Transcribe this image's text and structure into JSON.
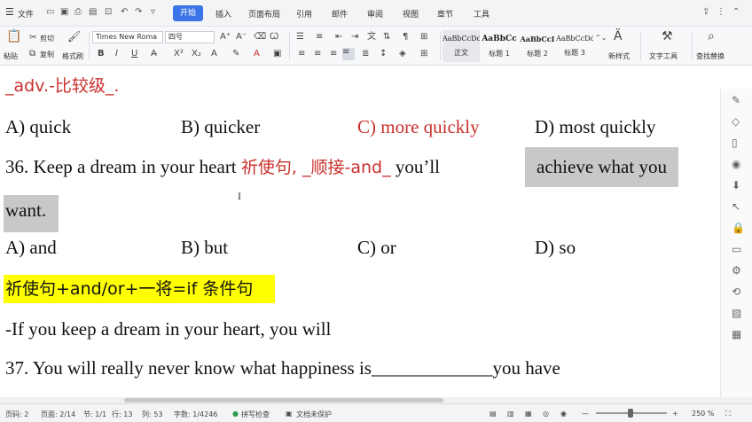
{
  "menubar": {
    "menu_icon": "☰",
    "file": "文件",
    "tabs": [
      "开始",
      "插入",
      "页面布局",
      "引用",
      "邮件",
      "审阅",
      "视图",
      "章节",
      "工具"
    ]
  },
  "ribbon": {
    "paste": "粘贴",
    "cut": "剪切",
    "copy": "复制",
    "format_painter": "格式刷",
    "font_name": "Times New Roma",
    "font_size": "四号",
    "styles": [
      {
        "sample": "AaBbCcDd",
        "name": "正文"
      },
      {
        "sample": "AaBbCc",
        "name": "标题 1"
      },
      {
        "sample": "AaBbCcI",
        "name": "标题 2"
      },
      {
        "sample": "AaBbCcDd",
        "name": "标题 3"
      }
    ],
    "new_style": "新样式",
    "text_tools": "文字工具",
    "find_replace": "查找替换"
  },
  "document": {
    "line1": "_adv.-比较级_.",
    "q35_options": [
      "A) quick",
      "B) quicker",
      "C) more quickly",
      "D) most quickly"
    ],
    "q36_prefix": "36. Keep a dream in your heart ",
    "q36_hint": "祈使句, _顺接-and_",
    "q36_middle": " you’ll ",
    "q36_highlight1": "achieve what you",
    "q36_highlight2": "want.",
    "q36_options": [
      "A) and",
      "B) but",
      "C) or",
      "D) so"
    ],
    "rule": "祈使句+and/or+一将=if 条件句",
    "example": "-If you keep a dream in your heart, you will",
    "q37": "37.  You  will  really  never  know  what  happiness  is_____________you  have"
  },
  "statusbar": {
    "page": "页码: 2",
    "pages": "页面: 2/14",
    "section": "节: 1/1",
    "row": "行: 13",
    "col": "列: 53",
    "words": "字数: 1/4246",
    "spell": "拼写检查",
    "protect": "文档未保护",
    "zoom": "250 %"
  },
  "colors": {
    "accent": "#3b74e6",
    "hint_red": "#c9302c",
    "highlight_yellow": "#ffff00",
    "selection_gray": "#c8c8c8"
  }
}
